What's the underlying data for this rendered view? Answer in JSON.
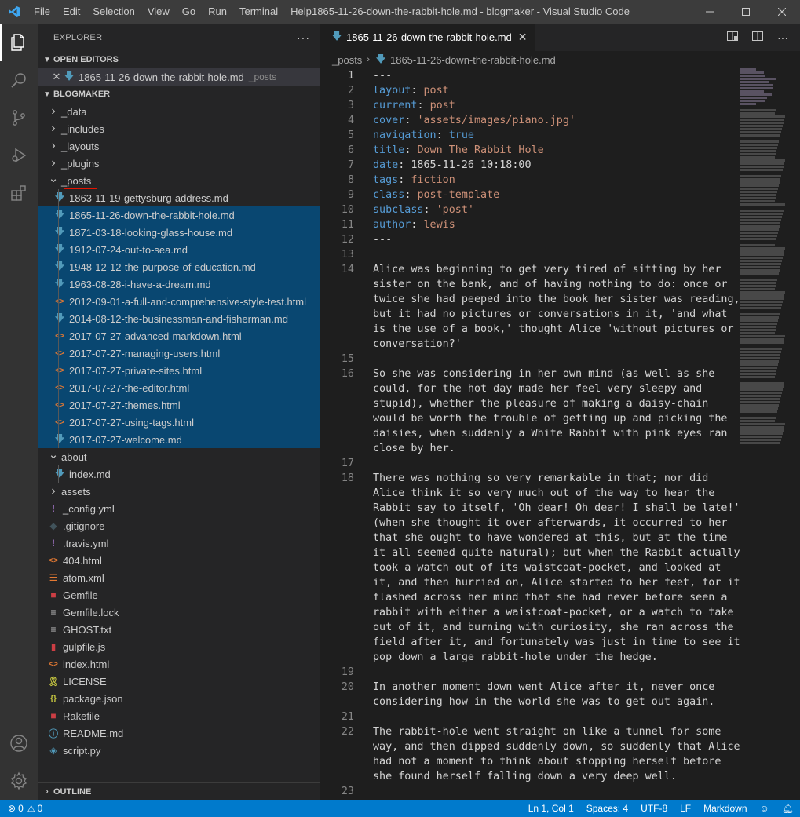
{
  "titlebar": {
    "menu": [
      "File",
      "Edit",
      "Selection",
      "View",
      "Go",
      "Run",
      "Terminal",
      "Help"
    ],
    "window_title": "1865-11-26-down-the-rabbit-hole.md - blogmaker - Visual Studio Code"
  },
  "sidebar": {
    "title": "EXPLORER",
    "open_editors_label": "OPEN EDITORS",
    "open_editor": {
      "name": "1865-11-26-down-the-rabbit-hole.md",
      "folder": "_posts"
    },
    "project_label": "BLOGMAKER",
    "outline_label": "OUTLINE",
    "tree": [
      {
        "name": "_data",
        "kind": "folder",
        "state": "collapsed",
        "depth": 0
      },
      {
        "name": "_includes",
        "kind": "folder",
        "state": "collapsed",
        "depth": 0
      },
      {
        "name": "_layouts",
        "kind": "folder",
        "state": "collapsed",
        "depth": 0
      },
      {
        "name": "_plugins",
        "kind": "folder",
        "state": "collapsed",
        "depth": 0
      },
      {
        "name": "_posts",
        "kind": "folder",
        "state": "expanded",
        "depth": 0
      },
      {
        "name": "1863-11-19-gettysburg-address.md",
        "kind": "md",
        "depth": 1,
        "selected": false
      },
      {
        "name": "1865-11-26-down-the-rabbit-hole.md",
        "kind": "md",
        "depth": 1,
        "selected": true
      },
      {
        "name": "1871-03-18-looking-glass-house.md",
        "kind": "md",
        "depth": 1,
        "selected": true
      },
      {
        "name": "1912-07-24-out-to-sea.md",
        "kind": "md",
        "depth": 1,
        "selected": true
      },
      {
        "name": "1948-12-12-the-purpose-of-education.md",
        "kind": "md",
        "depth": 1,
        "selected": true
      },
      {
        "name": "1963-08-28-i-have-a-dream.md",
        "kind": "md",
        "depth": 1,
        "selected": true
      },
      {
        "name": "2012-09-01-a-full-and-comprehensive-style-test.html",
        "kind": "html",
        "depth": 1,
        "selected": true
      },
      {
        "name": "2014-08-12-the-businessman-and-fisherman.md",
        "kind": "md",
        "depth": 1,
        "selected": true
      },
      {
        "name": "2017-07-27-advanced-markdown.html",
        "kind": "html",
        "depth": 1,
        "selected": true
      },
      {
        "name": "2017-07-27-managing-users.html",
        "kind": "html",
        "depth": 1,
        "selected": true
      },
      {
        "name": "2017-07-27-private-sites.html",
        "kind": "html",
        "depth": 1,
        "selected": true
      },
      {
        "name": "2017-07-27-the-editor.html",
        "kind": "html",
        "depth": 1,
        "selected": true
      },
      {
        "name": "2017-07-27-themes.html",
        "kind": "html",
        "depth": 1,
        "selected": true
      },
      {
        "name": "2017-07-27-using-tags.html",
        "kind": "html",
        "depth": 1,
        "selected": true
      },
      {
        "name": "2017-07-27-welcome.md",
        "kind": "md",
        "depth": 1,
        "selected": true
      },
      {
        "name": "about",
        "kind": "folder",
        "state": "expanded",
        "depth": 0
      },
      {
        "name": "index.md",
        "kind": "md",
        "depth": 1,
        "selected": false
      },
      {
        "name": "assets",
        "kind": "folder",
        "state": "collapsed",
        "depth": 0
      },
      {
        "name": "_config.yml",
        "kind": "yml",
        "depth": 0
      },
      {
        "name": ".gitignore",
        "kind": "git",
        "depth": 0
      },
      {
        "name": ".travis.yml",
        "kind": "yml",
        "depth": 0
      },
      {
        "name": "404.html",
        "kind": "html",
        "depth": 0
      },
      {
        "name": "atom.xml",
        "kind": "rss",
        "depth": 0
      },
      {
        "name": "Gemfile",
        "kind": "ruby",
        "depth": 0
      },
      {
        "name": "Gemfile.lock",
        "kind": "text",
        "depth": 0
      },
      {
        "name": "GHOST.txt",
        "kind": "text",
        "depth": 0
      },
      {
        "name": "gulpfile.js",
        "kind": "gulp",
        "depth": 0
      },
      {
        "name": "index.html",
        "kind": "html",
        "depth": 0
      },
      {
        "name": "LICENSE",
        "kind": "license",
        "depth": 0
      },
      {
        "name": "package.json",
        "kind": "json",
        "depth": 0
      },
      {
        "name": "Rakefile",
        "kind": "ruby",
        "depth": 0
      },
      {
        "name": "README.md",
        "kind": "info",
        "depth": 0
      },
      {
        "name": "script.py",
        "kind": "python",
        "depth": 0
      }
    ]
  },
  "editor": {
    "tab_label": "1865-11-26-down-the-rabbit-hole.md",
    "breadcrumb": [
      "_posts",
      "1865-11-26-down-the-rabbit-hole.md"
    ],
    "lines": [
      {
        "n": "1",
        "parts": [
          [
            "n",
            "---"
          ]
        ]
      },
      {
        "n": "2",
        "parts": [
          [
            "k",
            "layout"
          ],
          [
            "n",
            ": "
          ],
          [
            "s",
            "post"
          ]
        ]
      },
      {
        "n": "3",
        "parts": [
          [
            "k",
            "current"
          ],
          [
            "n",
            ": "
          ],
          [
            "s",
            "post"
          ]
        ]
      },
      {
        "n": "4",
        "parts": [
          [
            "k",
            "cover"
          ],
          [
            "n",
            ": "
          ],
          [
            "s",
            "'assets/images/piano.jpg'"
          ]
        ]
      },
      {
        "n": "5",
        "parts": [
          [
            "k",
            "navigation"
          ],
          [
            "n",
            ": "
          ],
          [
            "k",
            "true"
          ]
        ]
      },
      {
        "n": "6",
        "parts": [
          [
            "k",
            "title"
          ],
          [
            "n",
            ": "
          ],
          [
            "s",
            "Down The Rabbit Hole"
          ]
        ]
      },
      {
        "n": "7",
        "parts": [
          [
            "k",
            "date"
          ],
          [
            "n",
            ": 1865-11-26 10:18:00"
          ]
        ]
      },
      {
        "n": "8",
        "parts": [
          [
            "k",
            "tags"
          ],
          [
            "n",
            ": "
          ],
          [
            "s",
            "fiction"
          ]
        ]
      },
      {
        "n": "9",
        "parts": [
          [
            "k",
            "class"
          ],
          [
            "n",
            ": "
          ],
          [
            "s",
            "post-template"
          ]
        ]
      },
      {
        "n": "10",
        "parts": [
          [
            "k",
            "subclass"
          ],
          [
            "n",
            ": "
          ],
          [
            "s",
            "'post'"
          ]
        ]
      },
      {
        "n": "11",
        "parts": [
          [
            "k",
            "author"
          ],
          [
            "n",
            ": "
          ],
          [
            "s",
            "lewis"
          ]
        ]
      },
      {
        "n": "12",
        "parts": [
          [
            "n",
            "---"
          ]
        ]
      },
      {
        "n": "13",
        "parts": [
          [
            "n",
            ""
          ]
        ]
      },
      {
        "n": "14",
        "parts": [
          [
            "n",
            "Alice was beginning to get very tired of sitting by her"
          ]
        ]
      },
      {
        "n": "",
        "parts": [
          [
            "n",
            "sister on the bank, and of having nothing to do: once or"
          ]
        ]
      },
      {
        "n": "",
        "parts": [
          [
            "n",
            "twice she had peeped into the book her sister was reading,"
          ]
        ]
      },
      {
        "n": "",
        "parts": [
          [
            "n",
            "but it had no pictures or conversations in it, 'and what"
          ]
        ]
      },
      {
        "n": "",
        "parts": [
          [
            "n",
            "is the use of a book,' thought Alice 'without pictures or"
          ]
        ]
      },
      {
        "n": "",
        "parts": [
          [
            "n",
            "conversation?'"
          ]
        ]
      },
      {
        "n": "15",
        "parts": [
          [
            "n",
            ""
          ]
        ]
      },
      {
        "n": "16",
        "parts": [
          [
            "n",
            "So she was considering in her own mind (as well as she"
          ]
        ]
      },
      {
        "n": "",
        "parts": [
          [
            "n",
            "could, for the hot day made her feel very sleepy and"
          ]
        ]
      },
      {
        "n": "",
        "parts": [
          [
            "n",
            "stupid), whether the pleasure of making a daisy-chain"
          ]
        ]
      },
      {
        "n": "",
        "parts": [
          [
            "n",
            "would be worth the trouble of getting up and picking the"
          ]
        ]
      },
      {
        "n": "",
        "parts": [
          [
            "n",
            "daisies, when suddenly a White Rabbit with pink eyes ran"
          ]
        ]
      },
      {
        "n": "",
        "parts": [
          [
            "n",
            "close by her."
          ]
        ]
      },
      {
        "n": "17",
        "parts": [
          [
            "n",
            ""
          ]
        ]
      },
      {
        "n": "18",
        "parts": [
          [
            "n",
            "There was nothing so very remarkable in that; nor did"
          ]
        ]
      },
      {
        "n": "",
        "parts": [
          [
            "n",
            "Alice think it so very much out of the way to hear the"
          ]
        ]
      },
      {
        "n": "",
        "parts": [
          [
            "n",
            "Rabbit say to itself, 'Oh dear! Oh dear! I shall be late!'"
          ]
        ]
      },
      {
        "n": "",
        "parts": [
          [
            "n",
            "(when she thought it over afterwards, it occurred to her"
          ]
        ]
      },
      {
        "n": "",
        "parts": [
          [
            "n",
            "that she ought to have wondered at this, but at the time"
          ]
        ]
      },
      {
        "n": "",
        "parts": [
          [
            "n",
            "it all seemed quite natural); but when the Rabbit actually"
          ]
        ]
      },
      {
        "n": "",
        "parts": [
          [
            "n",
            "took a watch out of its waistcoat-pocket, and looked at"
          ]
        ]
      },
      {
        "n": "",
        "parts": [
          [
            "n",
            "it, and then hurried on, Alice started to her feet, for it"
          ]
        ]
      },
      {
        "n": "",
        "parts": [
          [
            "n",
            "flashed across her mind that she had never before seen a"
          ]
        ]
      },
      {
        "n": "",
        "parts": [
          [
            "n",
            "rabbit with either a waistcoat-pocket, or a watch to take"
          ]
        ]
      },
      {
        "n": "",
        "parts": [
          [
            "n",
            "out of it, and burning with curiosity, she ran across the"
          ]
        ]
      },
      {
        "n": "",
        "parts": [
          [
            "n",
            "field after it, and fortunately was just in time to see it"
          ]
        ]
      },
      {
        "n": "",
        "parts": [
          [
            "n",
            "pop down a large rabbit-hole under the hedge."
          ]
        ]
      },
      {
        "n": "19",
        "parts": [
          [
            "n",
            ""
          ]
        ]
      },
      {
        "n": "20",
        "parts": [
          [
            "n",
            "In another moment down went Alice after it, never once"
          ]
        ]
      },
      {
        "n": "",
        "parts": [
          [
            "n",
            "considering how in the world she was to get out again."
          ]
        ]
      },
      {
        "n": "21",
        "parts": [
          [
            "n",
            ""
          ]
        ]
      },
      {
        "n": "22",
        "parts": [
          [
            "n",
            "The rabbit-hole went straight on like a tunnel for some"
          ]
        ]
      },
      {
        "n": "",
        "parts": [
          [
            "n",
            "way, and then dipped suddenly down, so suddenly that Alice"
          ]
        ]
      },
      {
        "n": "",
        "parts": [
          [
            "n",
            "had not a moment to think about stopping herself before"
          ]
        ]
      },
      {
        "n": "",
        "parts": [
          [
            "n",
            "she found herself falling down a very deep well."
          ]
        ]
      },
      {
        "n": "23",
        "parts": [
          [
            "n",
            ""
          ]
        ]
      }
    ]
  },
  "statusbar": {
    "errors": "0",
    "warnings": "0",
    "position": "Ln 1, Col 1",
    "spaces": "Spaces: 4",
    "encoding": "UTF-8",
    "eol": "LF",
    "language": "Markdown"
  },
  "colors": {
    "accent": "#007acc",
    "selection": "#094771",
    "keyword": "#569cd6",
    "string": "#ce9178",
    "md_icon": "#519aba",
    "html_icon": "#e37933",
    "yml_icon": "#a074c4",
    "ruby_icon": "#cc3e44"
  }
}
